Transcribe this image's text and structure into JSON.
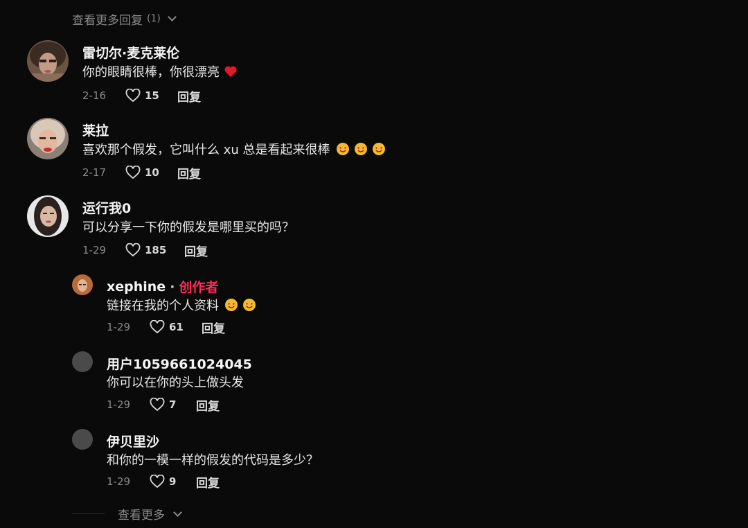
{
  "top_more": {
    "label": "查看更多回复",
    "count": "(1)"
  },
  "comments": [
    {
      "username": "雷切尔·麦克莱伦",
      "text": "你的眼睛很棒，你很漂亮",
      "date": "2-16",
      "likes": "15",
      "reply": "回复",
      "emoji": "red-heart"
    },
    {
      "username": "莱拉",
      "text": "喜欢那个假发，它叫什么 xu 总是看起来很棒",
      "date": "2-17",
      "likes": "10",
      "reply": "回复",
      "emoji": "heart-eyes-face"
    },
    {
      "username": "运行我0",
      "text": "可以分享一下你的假发是哪里买的吗？",
      "date": "1-29",
      "likes": "185",
      "reply": "回复"
    }
  ],
  "replies": [
    {
      "username": "xephine",
      "creator_dot": "·",
      "creator_label": "创作者",
      "text": "链接在我的个人资料",
      "date": "1-29",
      "likes": "61",
      "reply": "回复",
      "emoji": "heart-eyes-face"
    },
    {
      "username": "用户1059661024045",
      "text": "你可以在你的头上做头发",
      "date": "1-29",
      "likes": "7",
      "reply": "回复"
    },
    {
      "username": "伊贝里沙",
      "text": "和你的一模一样的假发的代码是多少？",
      "date": "1-29",
      "likes": "9",
      "reply": "回复"
    }
  ],
  "bottom_more": {
    "label": "查看更多"
  },
  "colors": {
    "background": "#0a0a0a",
    "creator": "#fe2c55",
    "heart": "#e5182b",
    "muted": "#8a8a8a"
  }
}
